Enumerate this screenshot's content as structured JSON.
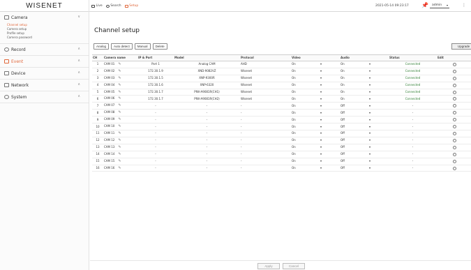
{
  "app": {
    "logo": "WISENET"
  },
  "topnav": [
    {
      "label": "Live",
      "icon": "monitor-icon",
      "active": false
    },
    {
      "label": "Search",
      "icon": "search-icon",
      "active": false
    },
    {
      "label": "Setup",
      "icon": "setup-icon",
      "active": true
    }
  ],
  "header": {
    "datetime": "2021-05-14 09:23:17",
    "user": "admin"
  },
  "sidebar": {
    "groups": [
      {
        "label": "Camera",
        "icon": "camera-icon",
        "expanded": true,
        "items": [
          {
            "label": "Channel setup",
            "active": true
          },
          {
            "label": "Camera setup",
            "active": false
          },
          {
            "label": "Profile setup",
            "active": false
          },
          {
            "label": "Camera password",
            "active": false
          }
        ]
      },
      {
        "label": "Record",
        "icon": "record-icon"
      },
      {
        "label": "Event",
        "icon": "event-icon",
        "accent": true
      },
      {
        "label": "Device",
        "icon": "device-icon"
      },
      {
        "label": "Network",
        "icon": "network-icon"
      },
      {
        "label": "System",
        "icon": "system-icon"
      }
    ]
  },
  "main": {
    "title": "Channel setup",
    "buttons": {
      "analog": "Analog",
      "auto_detect": "Auto detect",
      "manual": "Manual",
      "delete": "Delete",
      "upgrade": "Upgrade"
    },
    "columns": [
      "CH",
      "Camera name",
      "IP & Port",
      "Model",
      "Protocol",
      "Video",
      "",
      "Audio",
      "",
      "Status",
      "Edit"
    ],
    "rows": [
      [
        "1",
        "CAM 01",
        "Port 1",
        "Analog CAM",
        "AHD",
        "On",
        "▾",
        "On",
        "▾",
        "Connected"
      ],
      [
        "2",
        "CAM 02",
        "172.30.1.9",
        "XND-9082VZ",
        "Wisenet",
        "On",
        "▾",
        "On",
        "▾",
        "Connected"
      ],
      [
        "3",
        "CAM 03",
        "172.30.1.5",
        "XNP-9300R",
        "Wisenet",
        "On",
        "▾",
        "On",
        "▾",
        "Connected"
      ],
      [
        "4",
        "CAM 04",
        "172.30.1.6",
        "XNP-6320",
        "Wisenet",
        "On",
        "▾",
        "On",
        "▾",
        "Connected"
      ],
      [
        "5",
        "CAM 05",
        "172.30.1.7",
        "PNV-A9081R(CH1)",
        "Wisenet",
        "On",
        "▾",
        "On",
        "▾",
        "Connected"
      ],
      [
        "6",
        "CAM 06",
        "172.30.1.7",
        "PNV-A9081R(CH2)",
        "Wisenet",
        "On",
        "▾",
        "On",
        "▾",
        "Connected"
      ],
      [
        "7",
        "CAM 07",
        "-",
        "-",
        "-",
        "On",
        "▾",
        "Off",
        "▾",
        "-"
      ],
      [
        "8",
        "CAM 08",
        "-",
        "-",
        "-",
        "On",
        "▾",
        "Off",
        "▾",
        "-"
      ],
      [
        "9",
        "CAM 09",
        "-",
        "-",
        "-",
        "On",
        "▾",
        "Off",
        "▾",
        "-"
      ],
      [
        "10",
        "CAM 10",
        "-",
        "-",
        "-",
        "On",
        "▾",
        "Off",
        "▾",
        "-"
      ],
      [
        "11",
        "CAM 11",
        "-",
        "-",
        "-",
        "On",
        "▾",
        "Off",
        "▾",
        "-"
      ],
      [
        "12",
        "CAM 12",
        "-",
        "-",
        "-",
        "On",
        "▾",
        "Off",
        "▾",
        "-"
      ],
      [
        "13",
        "CAM 13",
        "-",
        "-",
        "-",
        "On",
        "▾",
        "Off",
        "▾",
        "-"
      ],
      [
        "14",
        "CAM 14",
        "-",
        "-",
        "-",
        "On",
        "▾",
        "Off",
        "▾",
        "-"
      ],
      [
        "15",
        "CAM 15",
        "-",
        "-",
        "-",
        "On",
        "▾",
        "Off",
        "▾",
        "-"
      ],
      [
        "16",
        "CAM 16",
        "-",
        "-",
        "-",
        "On",
        "▾",
        "Off",
        "▾",
        "-"
      ]
    ],
    "footer": {
      "apply": "Apply",
      "cancel": "Cancel"
    }
  },
  "colors": {
    "accent": "#e0673a",
    "connected": "#2e7d32"
  }
}
